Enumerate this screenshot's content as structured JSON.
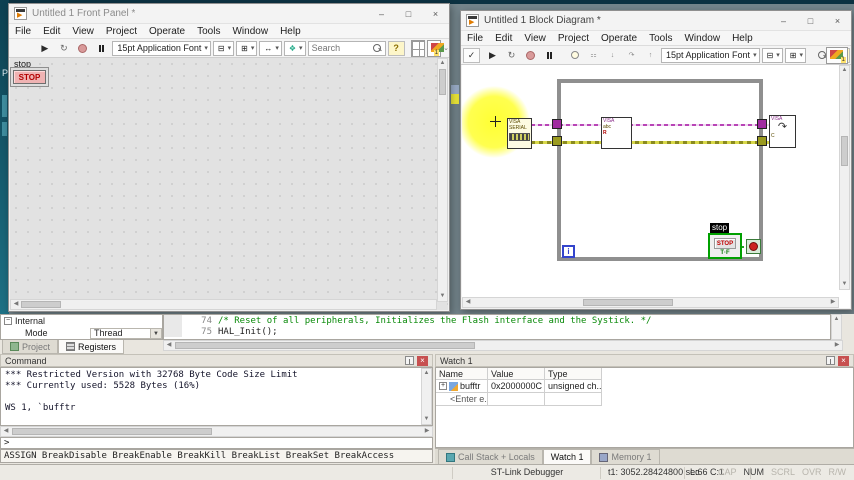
{
  "front_panel": {
    "title": "Untitled 1 Front Panel *",
    "menu": [
      "File",
      "Edit",
      "View",
      "Project",
      "Operate",
      "Tools",
      "Window",
      "Help"
    ],
    "toolbar": {
      "font_selector": "15pt Application Font",
      "search_placeholder": "Search",
      "help_glyph": "?"
    },
    "panel": {
      "stop_label": "stop",
      "stop_button": "STOP"
    }
  },
  "block_diagram": {
    "title": "Untitled 1 Block Diagram *",
    "menu": [
      "File",
      "Edit",
      "View",
      "Project",
      "Operate",
      "Tools",
      "Window",
      "Help"
    ],
    "toolbar": {
      "font_selector": "15pt Application Font",
      "check_glyph": "✓",
      "help_glyph": "?"
    },
    "diagram": {
      "visa_serial_node": {
        "line1": "VISA",
        "line2": "SERIAL"
      },
      "visa_read_node": {
        "line1": "VISA",
        "line2": "abc",
        "line3": "R"
      },
      "visa_close_node": {
        "line1": "VISA",
        "glyph": "↷",
        "line2": "C"
      },
      "iteration_terminal": "i",
      "stop_label": "stop",
      "stop_button_text": "STOP",
      "stop_tf": "T·F"
    },
    "colors": {
      "visa_wire": "#b844b6",
      "error_wire": "#9a9a20",
      "loop_border": "#8f8f8f"
    }
  },
  "debugger": {
    "registers": {
      "root": "Internal",
      "mode_label": "Mode",
      "mode_value": "Thread",
      "tabs": {
        "project": "Project",
        "registers": "Registers"
      }
    },
    "editor": {
      "lines": [
        {
          "number": "74",
          "text": "/* Reset of all peripherals, Initializes the Flash interface and the Systick. */"
        },
        {
          "number": "75",
          "text": "HAL_Init();"
        }
      ]
    },
    "command": {
      "title": "Command",
      "output_lines": [
        "*** Restricted Version with 32768 Byte Code Size Limit",
        "*** Currently used: 5528 Bytes (16%)",
        "",
        "WS 1, `bufftr"
      ],
      "prompt": ">",
      "assign_bar": "ASSIGN BreakDisable BreakEnable BreakKill BreakList BreakSet BreakAccess"
    },
    "watch": {
      "title": "Watch 1",
      "columns": [
        "Name",
        "Value",
        "Type"
      ],
      "rows": [
        {
          "name": "bufftr",
          "value": "0x2000000C ...",
          "type": "unsigned ch..."
        },
        {
          "name": "<Enter e...",
          "value": "",
          "type": ""
        }
      ]
    },
    "bottom_tabs": [
      "Call Stack + Locals",
      "Watch 1",
      "Memory 1"
    ],
    "status_bar": {
      "debugger_name": "ST-Link Debugger",
      "time": "t1: 3052.28424800 sec",
      "cursor": "L:66 C:1",
      "flags": [
        "CAP",
        "NUM",
        "SCRL",
        "OVR",
        "R/W"
      ]
    }
  }
}
